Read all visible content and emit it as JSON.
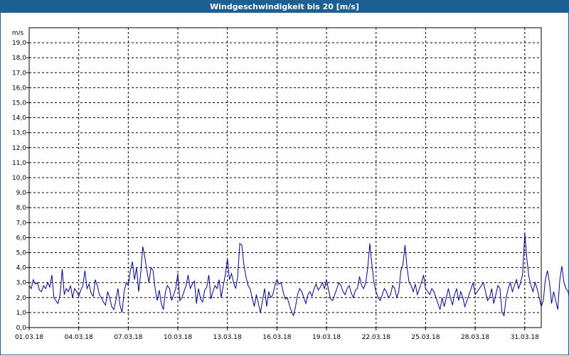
{
  "window": {
    "title": "Windgeschwindigkeit bis 20 [m/s]"
  },
  "colors": {
    "title_bar": "#1b5f93",
    "line": "#00008b",
    "grid": "#000000"
  },
  "chart_data": {
    "type": "line",
    "title": "Windgeschwindigkeit bis 20 [m/s]",
    "ylabel": "m/s",
    "xlabel": "",
    "ylim": [
      0,
      20
    ],
    "xlim": [
      "01.03.18",
      "01.04.18"
    ],
    "grid": true,
    "legend": "none",
    "y_ticks": [
      "0,0",
      "1,0",
      "2,0",
      "3,0",
      "4,0",
      "5,0",
      "6,0",
      "7,0",
      "8,0",
      "9,0",
      "10,0",
      "11,0",
      "12,0",
      "13,0",
      "14,0",
      "15,0",
      "16,0",
      "17,0",
      "18,0",
      "19,0"
    ],
    "x_ticks": [
      "01.03.18",
      "04.03.18",
      "07.03.18",
      "10.03.18",
      "13.03.18",
      "16.03.18",
      "19.03.18",
      "22.03.18",
      "25.03.18",
      "28.03.18",
      "31.03.18"
    ],
    "series": [
      {
        "x_start": "01.03.18 00:00",
        "x_step": "3h",
        "values": [
          2.8,
          2.6,
          3.2,
          2.9,
          3.0,
          2.5,
          2.4,
          2.8,
          2.6,
          3.0,
          2.7,
          3.5,
          2.0,
          1.8,
          1.6,
          2.2,
          3.9,
          2.2,
          2.6,
          2.4,
          2.8,
          2.0,
          2.6,
          2.4,
          2.1,
          2.5,
          2.8,
          3.8,
          2.6,
          2.9,
          2.3,
          2.1,
          3.2,
          2.8,
          2.2,
          2.0,
          1.7,
          1.5,
          2.4,
          2.0,
          1.4,
          1.2,
          1.8,
          2.6,
          1.5,
          1.0,
          2.4,
          3.0,
          2.8,
          3.8,
          4.4,
          3.2,
          4.0,
          2.4,
          3.6,
          5.4,
          4.7,
          3.8,
          3.0,
          4.0,
          3.8,
          2.6,
          1.8,
          2.5,
          1.6,
          1.2,
          2.4,
          2.8,
          2.6,
          1.8,
          2.2,
          2.6,
          3.6,
          1.8,
          2.0,
          2.4,
          2.8,
          3.5,
          2.6,
          2.9,
          3.1,
          1.6,
          2.6,
          1.9,
          1.7,
          2.5,
          2.7,
          3.5,
          1.9,
          2.4,
          2.8,
          2.6,
          3.2,
          2.0,
          2.8,
          3.5,
          4.6,
          3.2,
          3.6,
          3.0,
          2.6,
          3.4,
          5.6,
          5.5,
          4.2,
          3.4,
          2.8,
          2.6,
          2.0,
          1.4,
          2.2,
          1.6,
          1.0,
          1.8,
          2.6,
          1.4,
          2.4,
          2.0,
          2.2,
          2.8,
          3.2,
          2.9,
          3.0,
          2.4,
          1.9,
          2.0,
          1.5,
          1.1,
          0.8,
          1.4,
          2.2,
          2.6,
          2.4,
          2.0,
          1.6,
          2.2,
          2.4,
          2.1,
          2.6,
          2.9,
          2.5,
          2.7,
          3.0,
          2.6,
          3.2,
          2.5,
          1.9,
          1.8,
          2.2,
          2.6,
          3.0,
          2.8,
          2.4,
          2.2,
          2.6,
          2.8,
          2.3,
          2.0,
          2.5,
          2.6,
          3.4,
          2.8,
          2.6,
          3.0,
          4.0,
          5.6,
          4.2,
          3.0,
          2.4,
          2.0,
          1.8,
          2.2,
          2.6,
          2.4,
          2.0,
          2.2,
          2.8,
          2.6,
          2.0,
          2.4,
          3.8,
          4.2,
          5.5,
          4.0,
          3.0,
          2.8,
          2.4,
          2.9,
          2.2,
          2.6,
          3.0,
          3.5,
          2.6,
          2.4,
          2.2,
          2.6,
          2.4,
          2.0,
          1.6,
          1.2,
          2.0,
          1.4,
          2.0,
          2.6,
          2.0,
          1.5,
          2.2,
          2.6,
          1.8,
          2.4,
          2.0,
          1.4,
          1.8,
          2.2,
          2.6,
          3.0,
          2.2,
          2.4,
          2.6,
          2.8,
          3.0,
          2.4,
          1.8,
          2.0,
          2.6,
          1.6,
          2.2,
          2.8,
          2.6,
          1.0,
          0.8,
          2.0,
          2.6,
          3.0,
          2.4,
          2.8,
          3.2,
          2.6,
          3.0,
          3.6,
          6.3,
          4.6,
          3.4,
          2.8,
          2.4,
          3.0,
          2.6,
          2.0,
          1.4,
          1.8,
          3.2,
          3.8,
          3.0,
          1.6,
          2.4,
          1.8,
          1.2,
          3.2,
          4.1,
          3.0,
          2.6,
          2.4,
          1.8,
          1.6,
          2.0,
          1.8,
          2.4,
          2.8,
          2.6,
          1.8,
          3.4,
          2.2,
          2.6
        ]
      }
    ]
  }
}
